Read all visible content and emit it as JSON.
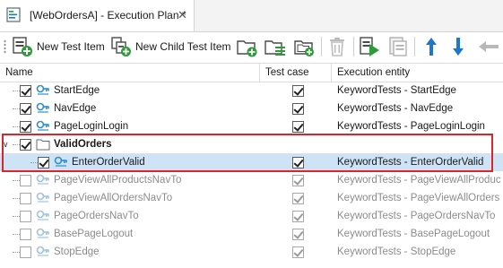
{
  "tab": {
    "title": "[WebOrdersA] - Execution Plan *",
    "close": "✕"
  },
  "toolbar": {
    "new_test_item": "New Test Item",
    "new_child_test_item": "New Child Test Item"
  },
  "columns": {
    "name": "Name",
    "test_case": "Test case",
    "execution_entity": "Execution entity"
  },
  "rows": [
    {
      "name": "StartEdge",
      "checked": true,
      "test_case": true,
      "entity": "KeywordTests - StartEdge",
      "enabled": true,
      "type": "test"
    },
    {
      "name": "NavEdge",
      "checked": true,
      "test_case": true,
      "entity": "KeywordTests - NavEdge",
      "enabled": true,
      "type": "test"
    },
    {
      "name": "PageLoginLogin",
      "checked": true,
      "test_case": true,
      "entity": "KeywordTests - PageLoginLogin",
      "enabled": true,
      "type": "test"
    },
    {
      "name": "ValidOrders",
      "checked": true,
      "test_case": false,
      "entity": "",
      "enabled": true,
      "type": "folder"
    },
    {
      "name": "EnterOrderValid",
      "checked": true,
      "test_case": true,
      "entity": "KeywordTests - EnterOrderValid",
      "enabled": true,
      "type": "test"
    },
    {
      "name": "PageViewAllProductsNavTo",
      "checked": false,
      "test_case": true,
      "entity": "KeywordTests - PageViewAllProduc...",
      "enabled": false,
      "type": "test"
    },
    {
      "name": "PageViewAllOrdersNavTo",
      "checked": false,
      "test_case": true,
      "entity": "KeywordTests - PageViewAllOrders...",
      "enabled": false,
      "type": "test"
    },
    {
      "name": "PageOrdersNavTo",
      "checked": false,
      "test_case": true,
      "entity": "KeywordTests - PageOrdersNavTo",
      "enabled": false,
      "type": "test"
    },
    {
      "name": "BasePageLogout",
      "checked": false,
      "test_case": true,
      "entity": "KeywordTests - BasePageLogout",
      "enabled": false,
      "type": "test"
    },
    {
      "name": "StopEdge",
      "checked": false,
      "test_case": true,
      "entity": "KeywordTests - StopEdge",
      "enabled": false,
      "type": "test"
    }
  ],
  "icons": {
    "tab": "execution-plan-icon",
    "new_test_item": "new-test-item-icon",
    "new_child": "new-child-test-item-icon",
    "new_folder": "new-folder-icon",
    "new_folder_list": "new-folder-list-icon",
    "new_child_folder": "new-child-folder-icon",
    "delete": "trash-icon",
    "run": "run-icon",
    "properties": "properties-icon",
    "move_up": "arrow-up-icon",
    "move_down": "arrow-down-icon",
    "move_left": "arrow-left-icon"
  },
  "colors": {
    "highlight": "#d9262c",
    "selection": "#cfe3f7",
    "accent_green": "#2e9b3a",
    "accent_blue": "#1e78c8"
  }
}
